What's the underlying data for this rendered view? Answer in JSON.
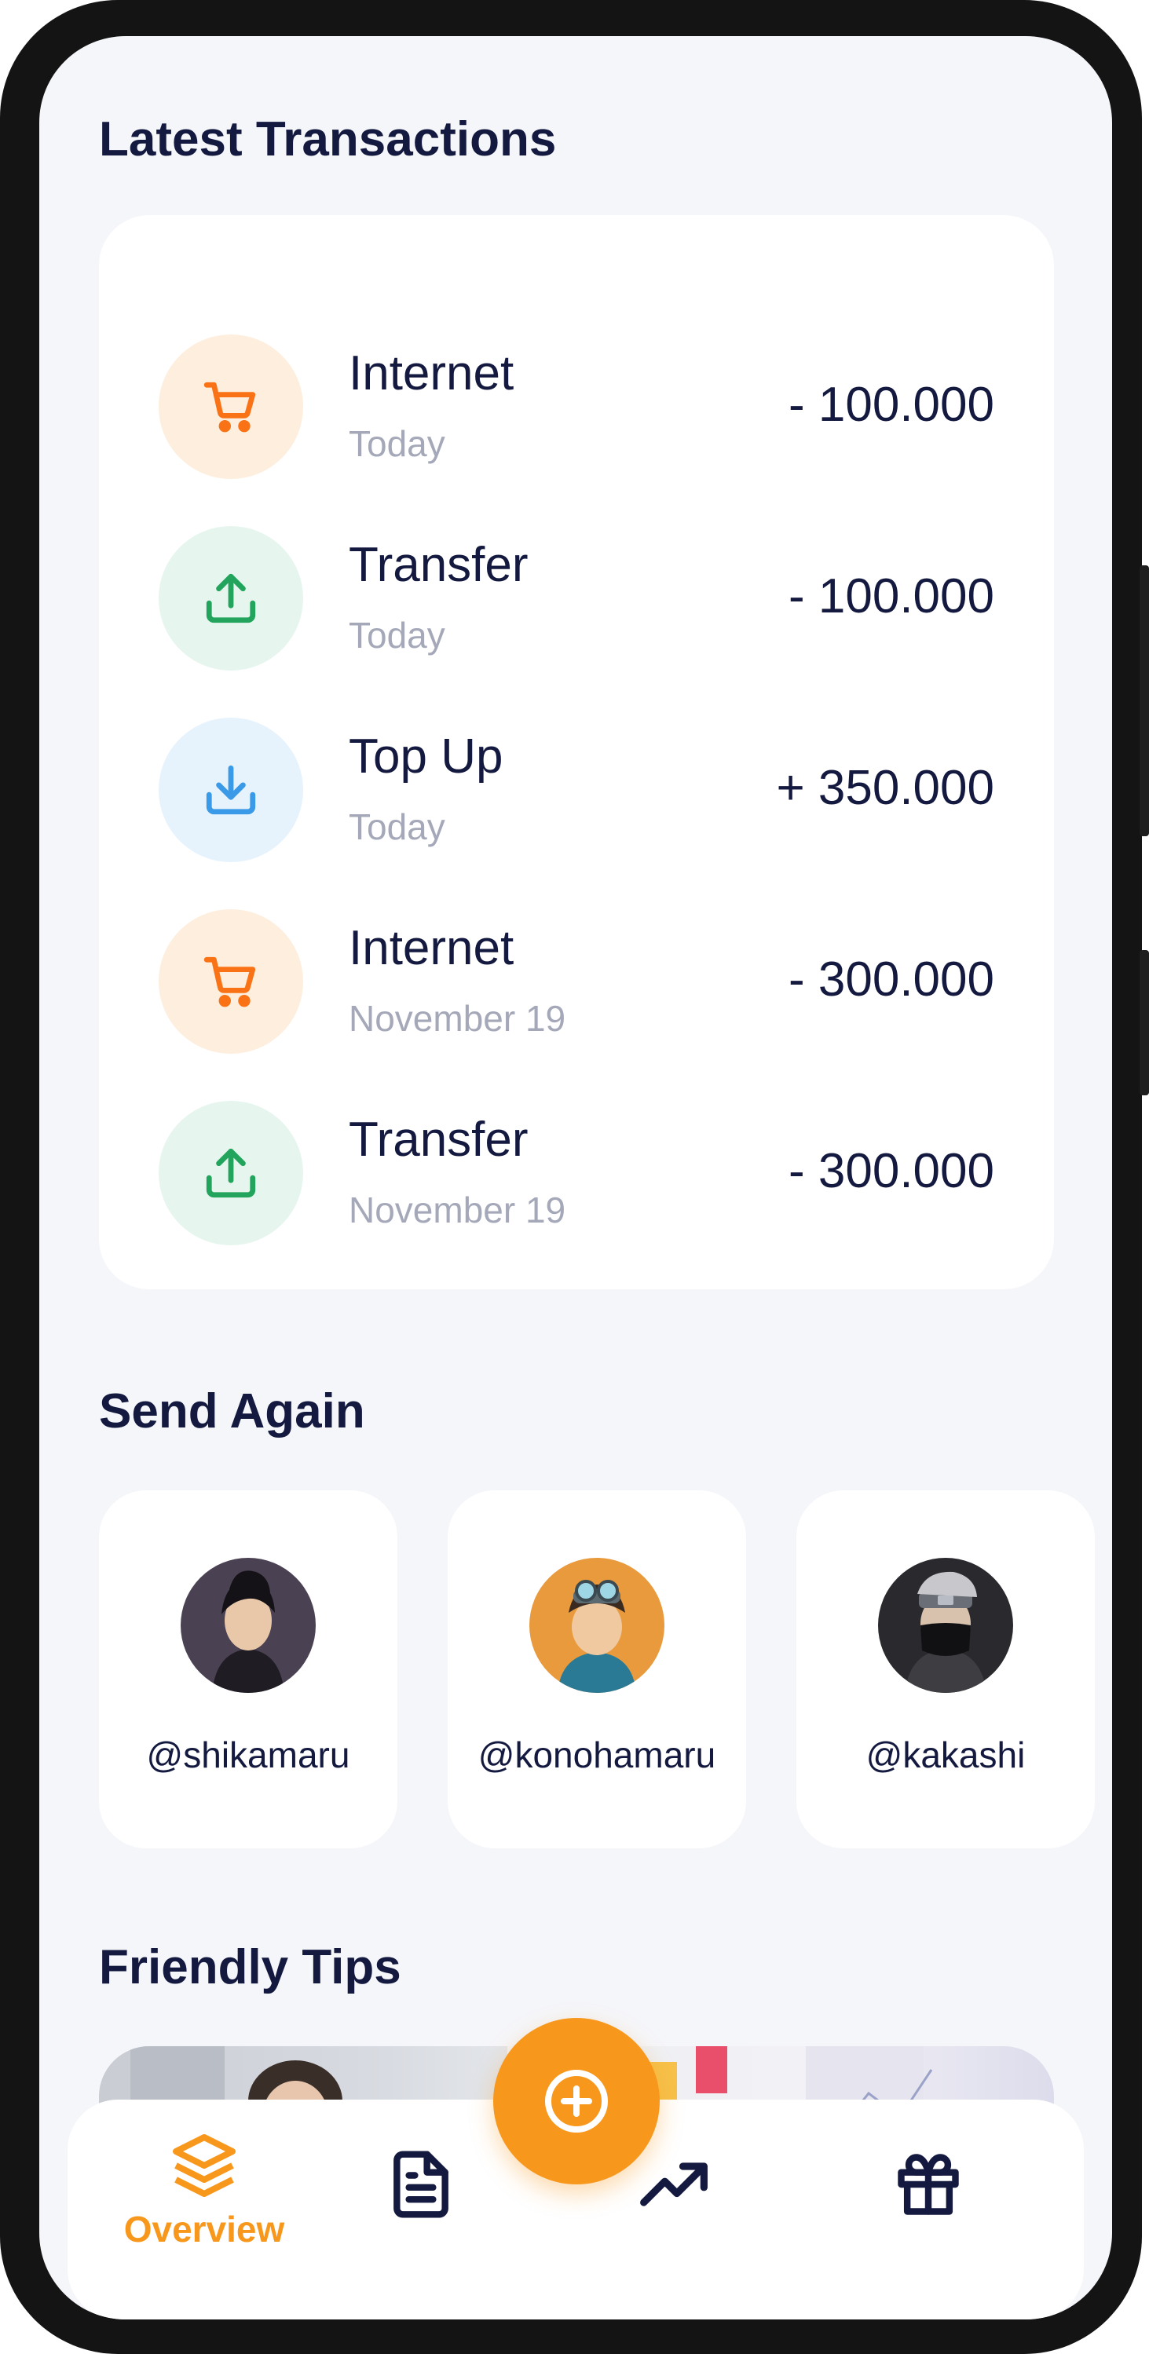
{
  "sections": {
    "transactions_title": "Latest Transactions",
    "send_again_title": "Send Again",
    "tips_title": "Friendly Tips"
  },
  "transactions": [
    {
      "name": "Internet",
      "date": "Today",
      "amount": "- 100.000",
      "icon": "cart-icon",
      "icon_color": "#f97316",
      "icon_bg": "#fdeedd"
    },
    {
      "name": "Transfer",
      "date": "Today",
      "amount": "- 100.000",
      "icon": "upload-icon",
      "icon_color": "#22a45d",
      "icon_bg": "#e6f6ee"
    },
    {
      "name": "Top Up",
      "date": "Today",
      "amount": "+ 350.000",
      "icon": "download-icon",
      "icon_color": "#3b9ae8",
      "icon_bg": "#e6f3fd"
    },
    {
      "name": "Internet",
      "date": "November 19",
      "amount": "- 300.000",
      "icon": "cart-icon",
      "icon_color": "#f97316",
      "icon_bg": "#fdeedd"
    },
    {
      "name": "Transfer",
      "date": "November 19",
      "amount": "- 300.000",
      "icon": "upload-icon",
      "icon_color": "#22a45d",
      "icon_bg": "#e6f6ee"
    }
  ],
  "send_again": [
    {
      "username": "@shikamaru"
    },
    {
      "username": "@konohamaru"
    },
    {
      "username": "@kakashi"
    }
  ],
  "bottom_nav": {
    "items": [
      {
        "label": "Overview",
        "icon": "layers-icon",
        "active": true
      },
      {
        "label": "",
        "icon": "document-icon",
        "active": false
      },
      {
        "label": "",
        "icon": "trend-up-icon",
        "active": false
      },
      {
        "label": "",
        "icon": "gift-icon",
        "active": false
      }
    ],
    "fab_icon": "plus-circle-icon"
  },
  "colors": {
    "accent": "#f7981c",
    "text_dark": "#14193f",
    "text_muted": "#a4a8b8",
    "background": "#f5f6fa",
    "card": "#ffffff"
  }
}
